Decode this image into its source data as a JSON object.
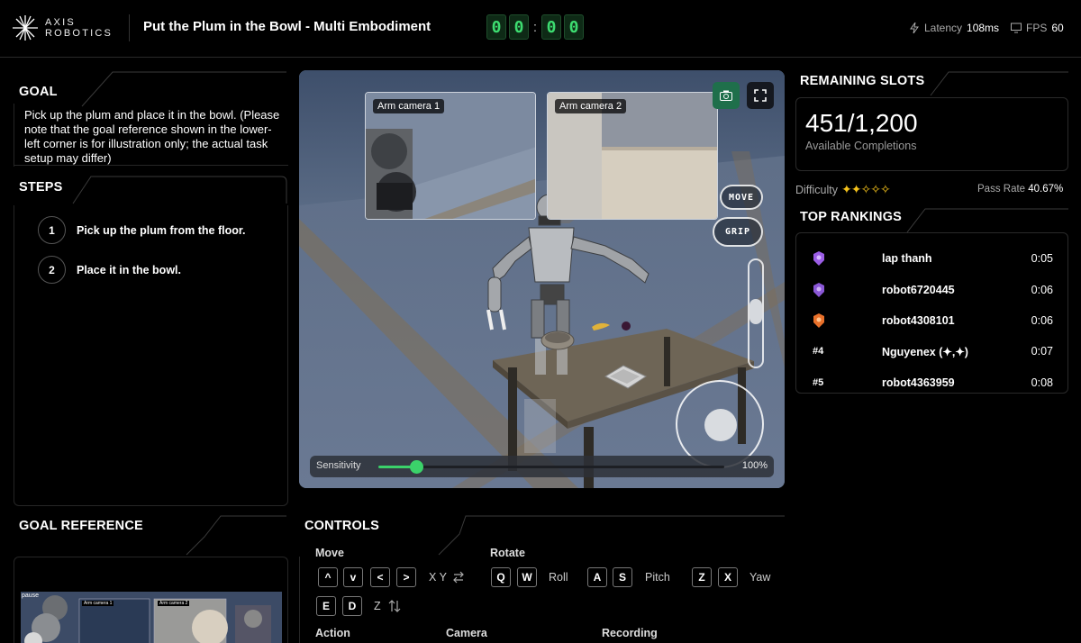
{
  "header": {
    "brand_line1": "AXIS",
    "brand_line2": "ROBOTICS",
    "task_title": "Put the Plum in the Bowl - Multi Embodiment",
    "timer": {
      "d1": "0",
      "d2": "0",
      "d3": "0",
      "d4": "0",
      "separator": ":"
    },
    "latency_label": "Latency",
    "latency_value": "108ms",
    "fps_label": "FPS",
    "fps_value": "60"
  },
  "goal": {
    "title": "GOAL",
    "text": "Pick up the plum and place it in the bowl. (Please note that the goal reference shown in the lower-left corner is for illustration only; the actual task setup may differ)"
  },
  "steps": {
    "title": "STEPS",
    "items": [
      {
        "num": "1",
        "text": "Pick up the plum from the floor."
      },
      {
        "num": "2",
        "text": "Place it in the bowl."
      }
    ]
  },
  "goal_reference": {
    "title": "GOAL REFERENCE",
    "pause_label": "pause",
    "cam1": "Arm camera 1",
    "cam2": "Arm camera 2"
  },
  "viewport": {
    "arm_camera_1": "Arm camera 1",
    "arm_camera_2": "Arm camera 2",
    "move_button": "MOVE",
    "grip_button": "GRIP",
    "sensitivity_label": "Sensitivity",
    "sensitivity_value": "100%",
    "sensitivity_fraction": 0.11,
    "vertical_slider_fraction": 0.5
  },
  "controls": {
    "title": "CONTROLS",
    "move_label": "Move",
    "move_keys": [
      "^",
      "v",
      "<",
      ">"
    ],
    "xy_label": "X Y",
    "z_keys": [
      "E",
      "D"
    ],
    "z_label": "Z",
    "rotate_label": "Rotate",
    "roll_keys": [
      "Q",
      "W"
    ],
    "roll_label": "Roll",
    "pitch_keys": [
      "A",
      "S"
    ],
    "pitch_label": "Pitch",
    "yaw_keys": [
      "Z",
      "X"
    ],
    "yaw_label": "Yaw",
    "action_label": "Action",
    "camera_label": "Camera",
    "recording_label": "Recording"
  },
  "slots": {
    "title": "REMAINING SLOTS",
    "value": "451/1,200",
    "subtitle": "Available Completions",
    "difficulty_label": "Difficulty",
    "difficulty_stars": "✦✦✧✧✧",
    "difficulty_rating": 2,
    "pass_rate_label": "Pass Rate",
    "pass_rate_value": "40.67%"
  },
  "rankings": {
    "title": "TOP RANKINGS",
    "rows": [
      {
        "pos": "",
        "name": "lap thanh",
        "time": "0:05"
      },
      {
        "pos": "",
        "name": "robot6720445",
        "time": "0:06"
      },
      {
        "pos": "",
        "name": "robot4308101",
        "time": "0:06"
      },
      {
        "pos": "#4",
        "name": "Nguyenex (✦,✦)",
        "time": "0:07"
      },
      {
        "pos": "#5",
        "name": "robot4363959",
        "time": "0:08"
      }
    ]
  },
  "colors": {
    "accent_green": "#3bd26a",
    "timer_green": "#3ddc70",
    "star_gold": "#f3c11b",
    "badge_purple": "#9b5de5",
    "badge_orange": "#e8702a"
  }
}
